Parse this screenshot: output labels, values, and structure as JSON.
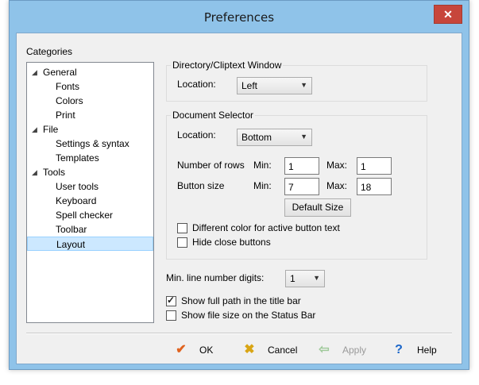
{
  "window": {
    "title": "Preferences",
    "close_glyph": "✕"
  },
  "categories": {
    "label": "Categories",
    "items": [
      {
        "label": "General",
        "level": 0,
        "expanded": true
      },
      {
        "label": "Fonts",
        "level": 1
      },
      {
        "label": "Colors",
        "level": 1
      },
      {
        "label": "Print",
        "level": 1
      },
      {
        "label": "File",
        "level": 0,
        "expanded": true
      },
      {
        "label": "Settings & syntax",
        "level": 1
      },
      {
        "label": "Templates",
        "level": 1
      },
      {
        "label": "Tools",
        "level": 0,
        "expanded": true
      },
      {
        "label": "User tools",
        "level": 1
      },
      {
        "label": "Keyboard",
        "level": 1
      },
      {
        "label": "Spell checker",
        "level": 1
      },
      {
        "label": "Toolbar",
        "level": 1
      },
      {
        "label": "Layout",
        "level": 1,
        "selected": true
      }
    ]
  },
  "directory_window": {
    "title": "Directory/Cliptext Window",
    "location_label": "Location:",
    "location_value": "Left"
  },
  "document_selector": {
    "title": "Document Selector",
    "location_label": "Location:",
    "location_value": "Bottom",
    "rows_label": "Number of rows",
    "size_label": "Button size",
    "min_label": "Min:",
    "max_label": "Max:",
    "rows_min": "1",
    "rows_max": "1",
    "size_min": "7",
    "size_max": "18",
    "default_size_button": "Default Size",
    "diff_color_label": "Different color for active button text",
    "diff_color_checked": false,
    "hide_close_label": "Hide close buttons",
    "hide_close_checked": false
  },
  "line_digits": {
    "label": "Min. line number digits:",
    "value": "1"
  },
  "options": {
    "full_path_label": "Show full path in the title bar",
    "full_path_checked": true,
    "file_size_label": "Show file size on the Status Bar",
    "file_size_checked": false
  },
  "footer": {
    "ok": "OK",
    "cancel": "Cancel",
    "apply": "Apply",
    "help": "Help"
  },
  "icons": {
    "ok": "check-icon",
    "cancel": "x-icon",
    "apply": "arrow-left-icon",
    "help": "question-icon"
  },
  "colors": {
    "ok": "#e0621e",
    "cancel": "#d9a514",
    "apply": "#9fc99a",
    "help": "#1b66c9"
  }
}
